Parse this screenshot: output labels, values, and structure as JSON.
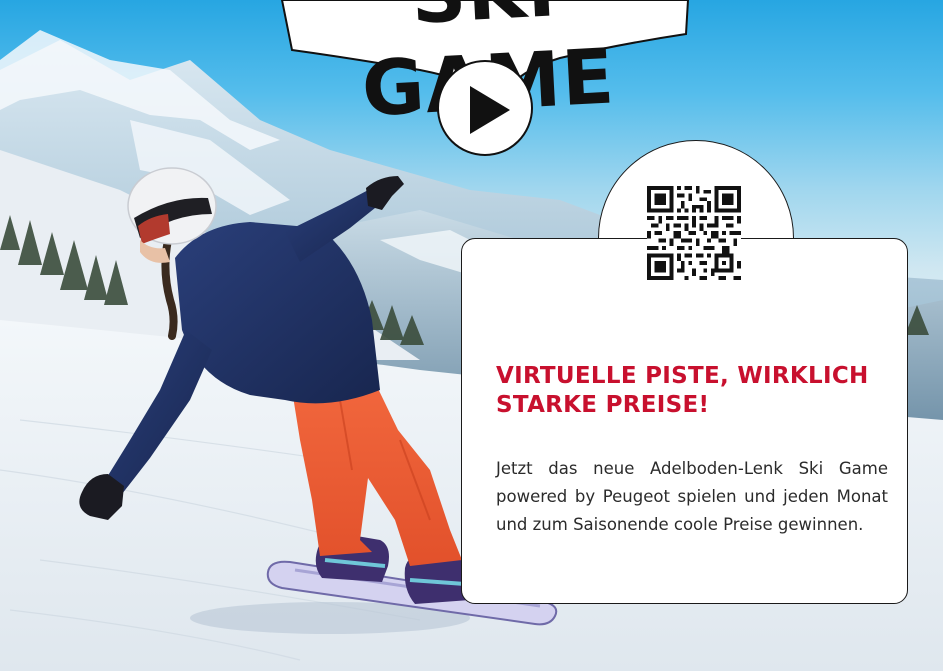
{
  "banner": {
    "title": "SKI GAME"
  },
  "play_button": {
    "icon": "play-icon"
  },
  "card": {
    "qr_icon": "qr-code-icon",
    "heading": "VIRTUELLE PISTE, WIRKLICH STARKE PREISE!",
    "body": "Jetzt das neue Adelboden-Lenk Ski Game powered by Peugeot spielen und jeden Monat und zum Saisonende coole Preise gewinnen.",
    "heading_color": "#c8102e"
  },
  "photo": {
    "subject": "snowboarder-photo"
  }
}
